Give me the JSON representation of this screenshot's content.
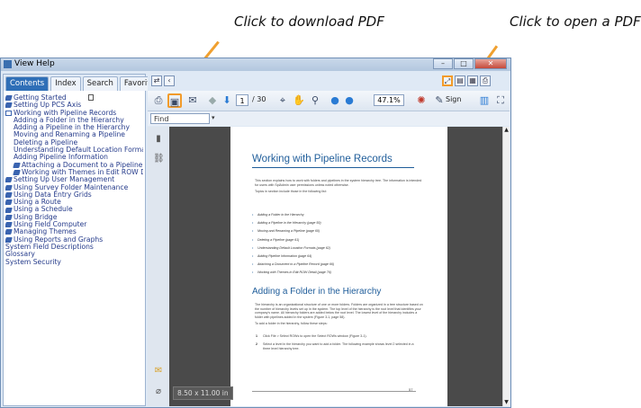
{
  "annotations": {
    "download": "Click to download PDF",
    "open": "Click to open a PDF"
  },
  "colors": {
    "arrow": "#f0a030",
    "accent": "#2f6fb7",
    "heading": "#1f5d9a"
  },
  "window": {
    "title": "View Help",
    "controls": [
      "minimize-icon",
      "maximize-icon",
      "close-icon"
    ]
  },
  "tabs": [
    {
      "label": "Contents",
      "active": true
    },
    {
      "label": "Index",
      "active": false
    },
    {
      "label": "Search",
      "active": false
    },
    {
      "label": "Favorites",
      "active": false
    }
  ],
  "tree": [
    {
      "label": "Getting Started",
      "icon": "book",
      "indent": 0
    },
    {
      "label": "Setting Up PCS Axis",
      "icon": "book",
      "indent": 0
    },
    {
      "label": "Working with Pipeline Records",
      "icon": "open",
      "indent": 0
    },
    {
      "label": "Adding a Folder in the Hierarchy",
      "icon": "page",
      "indent": 1
    },
    {
      "label": "Adding a Pipeline in the Hierarchy",
      "icon": "page",
      "indent": 1
    },
    {
      "label": "Moving and Renaming a Pipeline",
      "icon": "page",
      "indent": 1
    },
    {
      "label": "Deleting a Pipeline",
      "icon": "page",
      "indent": 1
    },
    {
      "label": "Understanding Default Location Formats",
      "icon": "page",
      "indent": 1
    },
    {
      "label": "Adding Pipeline Information",
      "icon": "page",
      "indent": 1
    },
    {
      "label": "Attaching a Document to a Pipeline Record",
      "icon": "book",
      "indent": 1
    },
    {
      "label": "Working with Themes in Edit ROW Detail",
      "icon": "book",
      "indent": 1
    },
    {
      "label": "Setting Up User Management",
      "icon": "book",
      "indent": 0
    },
    {
      "label": "Using Survey Folder Maintenance",
      "icon": "book",
      "indent": 0
    },
    {
      "label": "Using Data Entry Grids",
      "icon": "book",
      "indent": 0
    },
    {
      "label": "Using a Route",
      "icon": "book",
      "indent": 0
    },
    {
      "label": "Using a Schedule",
      "icon": "book",
      "indent": 0
    },
    {
      "label": "Using Bridge",
      "icon": "book",
      "indent": 0
    },
    {
      "label": "Using Field Computer",
      "icon": "book",
      "indent": 0
    },
    {
      "label": "Managing Themes",
      "icon": "book",
      "indent": 0
    },
    {
      "label": "Using Reports and Graphs",
      "icon": "book",
      "indent": 0
    },
    {
      "label": "System Field Descriptions",
      "icon": "page",
      "indent": 0
    },
    {
      "label": "Glossary",
      "icon": "page",
      "indent": 0
    },
    {
      "label": "System Security",
      "icon": "page",
      "indent": 0
    }
  ],
  "toolbar": {
    "page_current": "1",
    "page_total": "/ 30",
    "zoom": "47.1%",
    "sign": "Sign",
    "find_placeholder": "Find"
  },
  "page_size": "8.50 x 11.00 in",
  "document": {
    "title": "Working with Pipeline Records",
    "intro": "This section explains how to work with folders and pipelines in the system hierarchy tree. The information is intended for users with SpiAdmin user permissions unless noted otherwise.",
    "topics_intro": "Topics in section include those in the following list:",
    "topics": [
      "Adding a Folder in the Hierarchy",
      "Adding a Pipeline in the Hierarchy (page 59)",
      "Moving and Renaming a Pipeline (page 60)",
      "Deleting a Pipeline (page 61)",
      "Understanding Default Location Formats (page 62)",
      "Adding Pipeline Information (page 64)",
      "Attaching a Document to a Pipeline Record (page 66)",
      "Working with Themes in Edit ROW Detail (page 76)"
    ],
    "section_title": "Adding a Folder in the Hierarchy",
    "section_body": "The hierarchy is an organizational structure of one or more folders. Folders are organized in a tree structure based on the number of hierarchy levels set up in the system. The top level of the hierarchy is the root level that identifies your company's name. All hierarchy folders are added below the root level. The lowest level of the hierarchy includes a folder with pipelines added in the system (Figure 3-1, page 58).",
    "steps_intro": "To add a folder in the hierarchy, follow these steps:",
    "steps": [
      "Click File > Select ROWs to open the Select ROWs window (Figure 3-1).",
      "Select a level in the hierarchy you want to add a folder. The following example shows level 2 selected in a three level hierarchy tree."
    ],
    "page_number": "57"
  }
}
